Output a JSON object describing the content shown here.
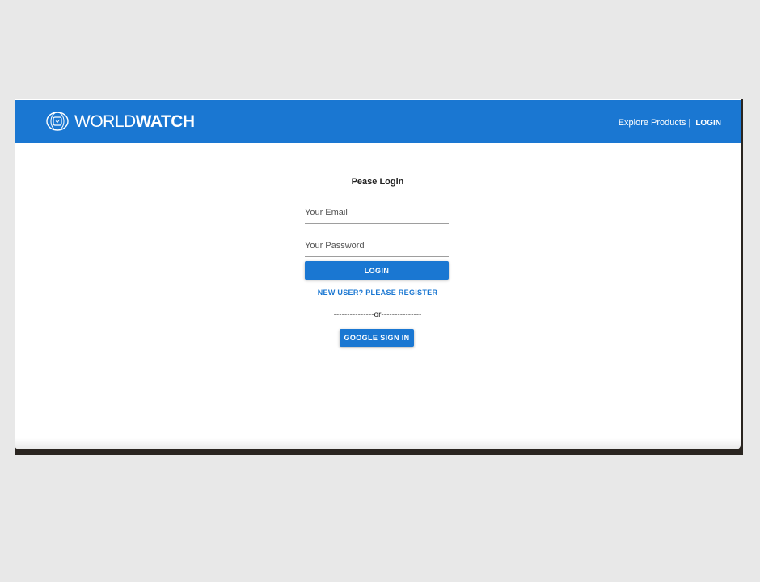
{
  "header": {
    "brand_thin": "WORLD",
    "brand_bold": "WATCH",
    "nav_explore": "Explore Products",
    "nav_separator": "|",
    "nav_login": "LOGIN",
    "color": "#1a77d2"
  },
  "login": {
    "title": "Pease Login",
    "email_placeholder": "Your Email",
    "email_value": "",
    "password_placeholder": "Your Password",
    "password_value": "",
    "login_button": "LOGIN",
    "register_link": "NEW USER? PLEASE REGISTER",
    "or_divider": "---------------or---------------",
    "google_button": "GOOGLE SIGN IN"
  },
  "icons": {
    "brand": "watch-globe-icon"
  }
}
